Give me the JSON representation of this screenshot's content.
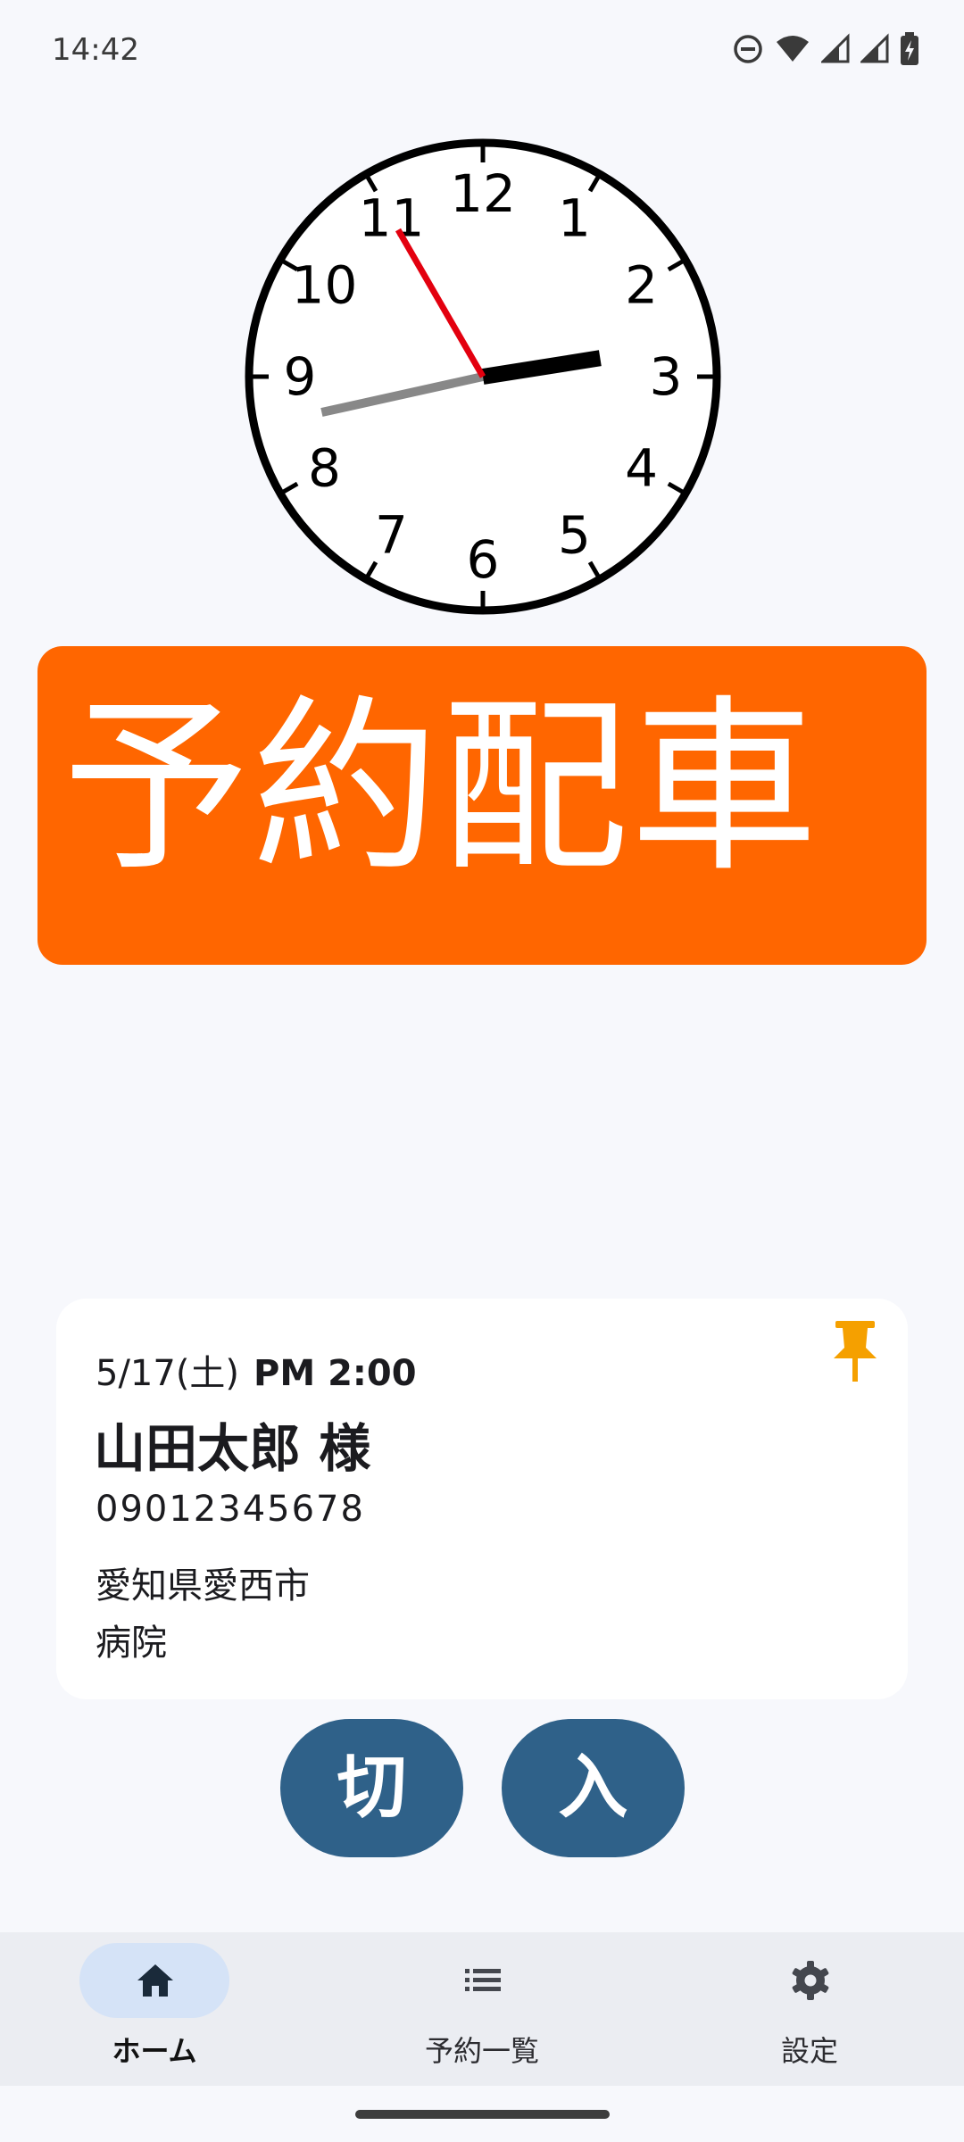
{
  "status_bar": {
    "time": "14:42",
    "icons": [
      "do-not-disturb-icon",
      "wifi-icon",
      "signal-icon",
      "signal-icon",
      "battery-charging-icon"
    ]
  },
  "clock": {
    "numerals": [
      "12",
      "1",
      "2",
      "3",
      "4",
      "5",
      "6",
      "7",
      "8",
      "9",
      "10",
      "11"
    ],
    "time_shown": {
      "hour": 2,
      "minute": 42,
      "second": 55
    },
    "colors": {
      "hour_hand": "#000000",
      "minute_hand": "#888888",
      "second_hand": "#e3000f"
    }
  },
  "banner": {
    "label": "予約配車",
    "color": "#ff6600"
  },
  "reservation": {
    "date": "5/17(土)",
    "time": "PM 2:00",
    "name": "山田太郎 様",
    "phone": "09012345678",
    "address_line1": "愛知県愛西市",
    "address_line2": "病院",
    "pin_icon": "pushpin-icon",
    "pin_color": "#f5a000"
  },
  "buttons": {
    "off_label": "切",
    "on_label": "入",
    "color": "#2f6189"
  },
  "nav": {
    "items": [
      {
        "label": "ホーム",
        "icon": "home-icon",
        "selected": true
      },
      {
        "label": "予約一覧",
        "icon": "list-icon",
        "selected": false
      },
      {
        "label": "設定",
        "icon": "gear-icon",
        "selected": false
      }
    ]
  }
}
